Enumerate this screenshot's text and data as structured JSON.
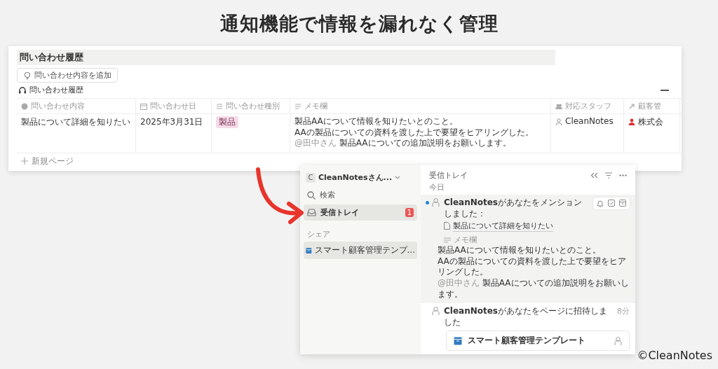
{
  "headline": "通知機能で情報を漏れなく管理",
  "database_view": {
    "title": "問い合わせ履歴",
    "add_button": "問い合わせ内容を追加",
    "view_tab": "問い合わせ履歴",
    "new_page": "新規ページ",
    "columns": [
      {
        "label": "問い合わせ内容",
        "kind": "title"
      },
      {
        "label": "問い合わせ日",
        "kind": "date"
      },
      {
        "label": "問い合わせ種別",
        "kind": "select"
      },
      {
        "label": "メモ欄",
        "kind": "text"
      },
      {
        "label": "対応スタッフ",
        "kind": "person"
      },
      {
        "label": "顧客管",
        "kind": "relation"
      }
    ],
    "rows": [
      {
        "inquiry": "製品について詳細を知りたい",
        "date": "2025年3月31日",
        "type_tag": "製品",
        "memo": {
          "lines": [
            "製品AAについて情報を知りたいとのこと。",
            "AAの製品についての資料を渡した上で要望をヒアリングした。"
          ],
          "mention": "@田中さん",
          "mention_text": "製品AAについての追加説明をお願いします。"
        },
        "staff": "CleanNotes",
        "column_6": "株式会"
      }
    ]
  },
  "sidebar": {
    "workspace": {
      "initial": "C",
      "name": "CleanNotesさん..."
    },
    "items": [
      {
        "label": "検索",
        "kind": "search",
        "selected": false
      },
      {
        "label": "受信トレイ",
        "kind": "inbox",
        "selected": true,
        "badge": "1"
      }
    ],
    "section": "シェア",
    "pages": [
      {
        "label": "スマート顧客管理テンプ...",
        "selected": true
      }
    ]
  },
  "inbox": {
    "title": "受信トレイ",
    "group": "今日",
    "notifications": [
      {
        "kind": "mention",
        "unread": true,
        "highlighted": true,
        "text": "**CleanNotes**があなたをメンションしました：",
        "page": "製品について詳細を知りたい",
        "field_label": "メモ欄",
        "memo": {
          "lines": [
            "製品AAについて情報を知りたいとのこと。",
            "AAの製品についての資料を渡した上で要望をヒアリングした。"
          ],
          "mention": "@田中さん",
          "mention_text": "製品AAについての追加説明をお願いします。"
        }
      },
      {
        "kind": "invite",
        "unread": false,
        "highlighted": false,
        "text": "**CleanNotes**があなたをページに招待しました",
        "time": "8分",
        "page": "スマート顧客管理テンプレート"
      }
    ]
  },
  "copyright": "©CleanNotes"
}
